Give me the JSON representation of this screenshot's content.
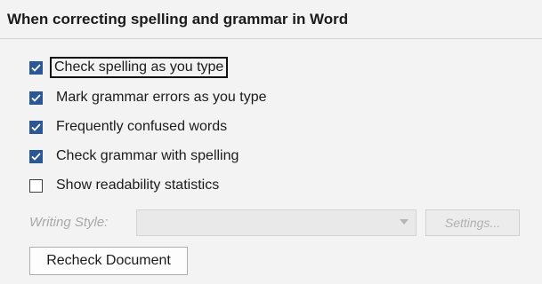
{
  "section": {
    "title": "When correcting spelling and grammar in Word"
  },
  "options": [
    {
      "label": "Check spelling as you type",
      "checked": true
    },
    {
      "label": "Mark grammar errors as you type",
      "checked": true
    },
    {
      "label": "Frequently confused words",
      "checked": true
    },
    {
      "label": "Check grammar with spelling",
      "checked": true
    },
    {
      "label": "Show readability statistics",
      "checked": false
    }
  ],
  "writing_style": {
    "label": "Writing Style:",
    "value": "",
    "enabled": false
  },
  "buttons": {
    "settings_label": "Settings...",
    "recheck_label": "Recheck Document"
  },
  "colors": {
    "checkbox_accent": "#2b5797",
    "disabled_text": "#a8a8a8",
    "background": "#f3f3f3"
  }
}
